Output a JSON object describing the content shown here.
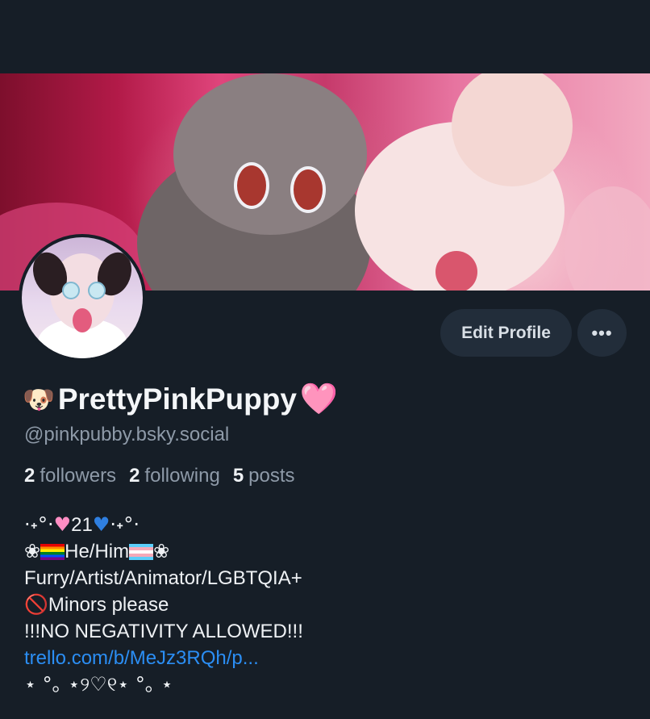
{
  "profile": {
    "name_emoji": "🐶",
    "display_name": "PrettyPinkPuppy",
    "name_suffix_emoji": "🩷",
    "handle": "@pinkpubby.bsky.social"
  },
  "stats": {
    "followers_count": "2",
    "followers_label": "followers",
    "following_count": "2",
    "following_label": "following",
    "posts_count": "5",
    "posts_label": "posts"
  },
  "actions": {
    "edit_profile": "Edit Profile",
    "more": "•••"
  },
  "bio": {
    "line1_pre": "·˖°·",
    "line1_heart": "♥",
    "line1_age": "21",
    "line1_heart2": "♥",
    "line1_post": "·˖°·",
    "line2_flower": "❀",
    "line2_text": "He/Him",
    "line2_flower2": "❀",
    "line3": "Furry/Artist/Animator/LGBTQIA+",
    "line4_icon": "🚫",
    "line4_text": "Minors please",
    "line5": "!!!NO NEGATIVITY ALLOWED!!!",
    "link": "trello.com/b/MeJz3RQh/p...",
    "line7": "⋆ °｡ ⋆୨♡୧⋆ °｡ ⋆"
  },
  "colors": {
    "background": "#161e27",
    "button_bg": "#222d3a",
    "muted_text": "#8e9aa8",
    "link": "#2b8ef4",
    "accent_pink": "#ff8ec4"
  }
}
